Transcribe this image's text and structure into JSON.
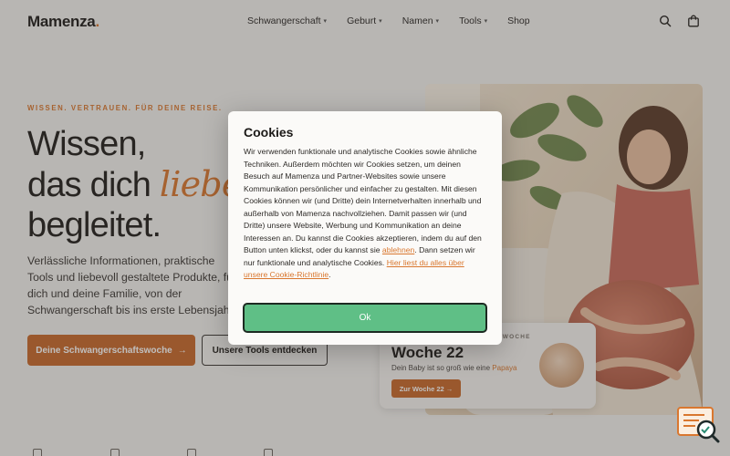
{
  "header": {
    "logo": "Mamenza",
    "logo_dot": ".",
    "nav": [
      {
        "label": "Schwangerschaft",
        "has_dropdown": true
      },
      {
        "label": "Geburt",
        "has_dropdown": true
      },
      {
        "label": "Namen",
        "has_dropdown": true
      },
      {
        "label": "Tools",
        "has_dropdown": true
      },
      {
        "label": "Shop",
        "has_dropdown": false
      }
    ],
    "icons": [
      "search-icon",
      "shopping-bag-icon"
    ]
  },
  "hero": {
    "eyebrow": "WISSEN. VERTRAUEN. FÜR DEINE REISE.",
    "headline_line1": "Wissen,",
    "headline_line2_a": "das dich ",
    "headline_line2_b": "liebevoll",
    "headline_line3": "begleitet.",
    "lead": "Verlässliche Informationen, praktische Tools und liebevoll gestaltete Produkte, für dich und deine Familie, von der Schwangerschaft bis ins erste Lebensjahr.",
    "primary_button": "Deine Schwangerschaftswoche",
    "primary_arrow": "→",
    "secondary_button": "Unsere Tools entdecken"
  },
  "week_card": {
    "eyebrow": "DEINE SCHWANGERSCHAFTSWOCHE",
    "title": "Woche 22",
    "subtitle": "Dein Baby ist so groß wie eine ",
    "fruit": "Papaya",
    "button": "Zur Woche 22 →"
  },
  "cookie_modal": {
    "title": "Cookies",
    "body_1": "Wir verwenden funktionale und analytische Cookies sowie ähnliche Techniken. Außerdem möchten wir Cookies setzen, um deinen Besuch auf Mamenza und Partner-Websites sowie unsere Kommunikation persönlicher und einfacher zu gestalten. Mit diesen Cookies können wir (und Dritte) dein Internetverhalten innerhalb und außerhalb von Mamenza nachvollziehen. Damit passen wir (und Dritte) unsere Website, Werbung und Kommunikation an deine Interessen an. Du kannst die Cookies akzeptieren, indem du auf den Button unten klickst, oder du kannst sie ",
    "decline_link": "ablehnen",
    "body_2": ". Dann setzen wir nur funktionale und analytische Cookies. ",
    "policy_link": "Hier liest du alles über unsere Cookie-Richtlinie",
    "body_3": ".",
    "ok_button": "Ok"
  },
  "colors": {
    "accent": "#d9772f",
    "button": "#c8682a",
    "ok_green": "#5fbf86",
    "background": "#f4f2ef"
  }
}
